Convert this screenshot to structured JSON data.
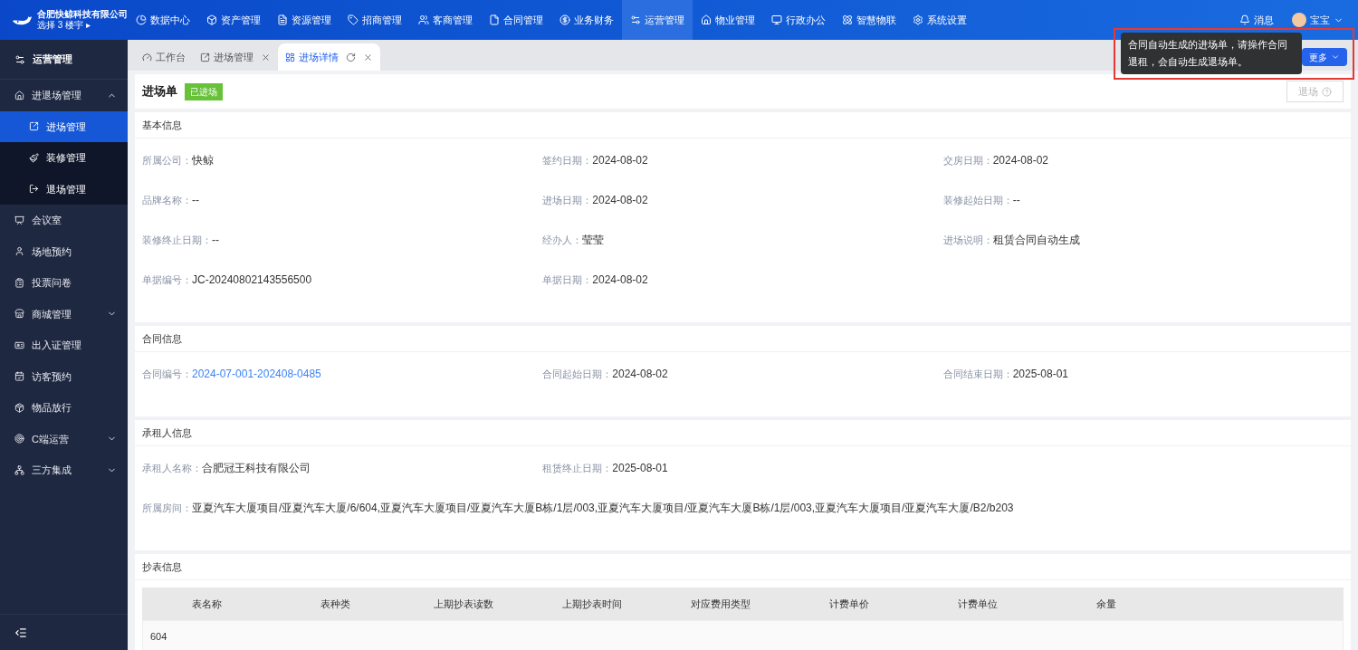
{
  "brand": {
    "company": "合肥快鲸科技有限公司",
    "building": "选择 3 楼宇",
    "caret": "▸"
  },
  "nav": [
    {
      "label": "数据中心",
      "selected": false
    },
    {
      "label": "资产管理",
      "selected": false
    },
    {
      "label": "资源管理",
      "selected": false
    },
    {
      "label": "招商管理",
      "selected": false
    },
    {
      "label": "客商管理",
      "selected": false
    },
    {
      "label": "合同管理",
      "selected": false
    },
    {
      "label": "业务财务",
      "selected": false
    },
    {
      "label": "运营管理",
      "selected": true
    },
    {
      "label": "物业管理",
      "selected": false
    },
    {
      "label": "行政办公",
      "selected": false
    },
    {
      "label": "智慧物联",
      "selected": false
    },
    {
      "label": "系统设置",
      "selected": false
    }
  ],
  "header_right": {
    "messages": "消息",
    "user": "宝宝"
  },
  "sidebar": {
    "title": "运营管理",
    "items": [
      {
        "label": "进退场管理",
        "expanded": true,
        "children": [
          {
            "label": "进场管理",
            "selected": true
          },
          {
            "label": "装修管理",
            "selected": false
          },
          {
            "label": "退场管理",
            "selected": false
          }
        ]
      },
      {
        "label": "会议室"
      },
      {
        "label": "场地预约"
      },
      {
        "label": "投票问卷"
      },
      {
        "label": "商城管理",
        "expanded": false
      },
      {
        "label": "出入证管理"
      },
      {
        "label": "访客预约"
      },
      {
        "label": "物品放行"
      },
      {
        "label": "C端运营",
        "expanded": false
      },
      {
        "label": "三方集成",
        "expanded": false
      }
    ]
  },
  "tabs": [
    {
      "label": "工作台",
      "selected": false
    },
    {
      "label": "进场管理",
      "selected": false,
      "closable": true
    },
    {
      "label": "进场详情",
      "selected": true,
      "closable": true,
      "refresh": true
    }
  ],
  "more_button": "更多",
  "tooltip": "合同自动生成的进场单，请操作合同退租，会自动生成退场单。",
  "page": {
    "title": "进场单",
    "status": "已进场",
    "exit_button": {
      "label": "退场",
      "disabled": true
    }
  },
  "sections": [
    {
      "title": "基本信息",
      "fields": [
        {
          "label": "所属公司：",
          "value": "快鲸",
          "kind": "text"
        },
        {
          "label": "签约日期：",
          "value": "2024-08-02",
          "kind": "text"
        },
        {
          "label": "交房日期：",
          "value": "2024-08-02",
          "kind": "text"
        },
        {
          "label": "品牌名称：",
          "value": "--",
          "kind": "text"
        },
        {
          "label": "进场日期：",
          "value": "2024-08-02",
          "kind": "text"
        },
        {
          "label": "装修起始日期：",
          "value": "--",
          "kind": "text"
        },
        {
          "label": "装修终止日期：",
          "value": "--",
          "kind": "text"
        },
        {
          "label": "经办人：",
          "value": "莹莹",
          "kind": "text"
        },
        {
          "label": "进场说明：",
          "value": "租赁合同自动生成",
          "kind": "text"
        },
        {
          "label": "单据编号：",
          "value": "JC-20240802143556500",
          "kind": "text"
        },
        {
          "label": "单据日期：",
          "value": "2024-08-02",
          "kind": "text"
        }
      ]
    },
    {
      "title": "合同信息",
      "fields": [
        {
          "label": "合同编号：",
          "value": "2024-07-001-202408-0485",
          "kind": "link"
        },
        {
          "label": "合同起始日期：",
          "value": "2024-08-02",
          "kind": "text"
        },
        {
          "label": "合同结束日期：",
          "value": "2025-08-01",
          "kind": "text"
        }
      ]
    },
    {
      "title": "承租人信息",
      "fields": [
        {
          "label": "承租人名称：",
          "value": "合肥冠王科技有限公司",
          "kind": "text"
        },
        {
          "label": "租赁终止日期：",
          "value": "2025-08-01",
          "kind": "text"
        },
        {
          "label": "所属房间：",
          "value": "亚夏汽车大厦项目/亚夏汽车大厦/6/604,亚夏汽车大厦项目/亚夏汽车大厦B栋/1层/003,亚夏汽车大厦项目/亚夏汽车大厦B栋/1层/003,亚夏汽车大厦项目/亚夏汽车大厦/B2/b203",
          "kind": "wide"
        }
      ]
    }
  ],
  "meter": {
    "title": "抄表信息",
    "columns": [
      "表名称",
      "表种类",
      "上期抄表读数",
      "上期抄表时间",
      "对应费用类型",
      "计费单价",
      "计费单位",
      "余量"
    ],
    "rows": [
      [
        "604",
        "",
        "",
        "",
        "",
        "",
        "",
        ""
      ]
    ]
  }
}
